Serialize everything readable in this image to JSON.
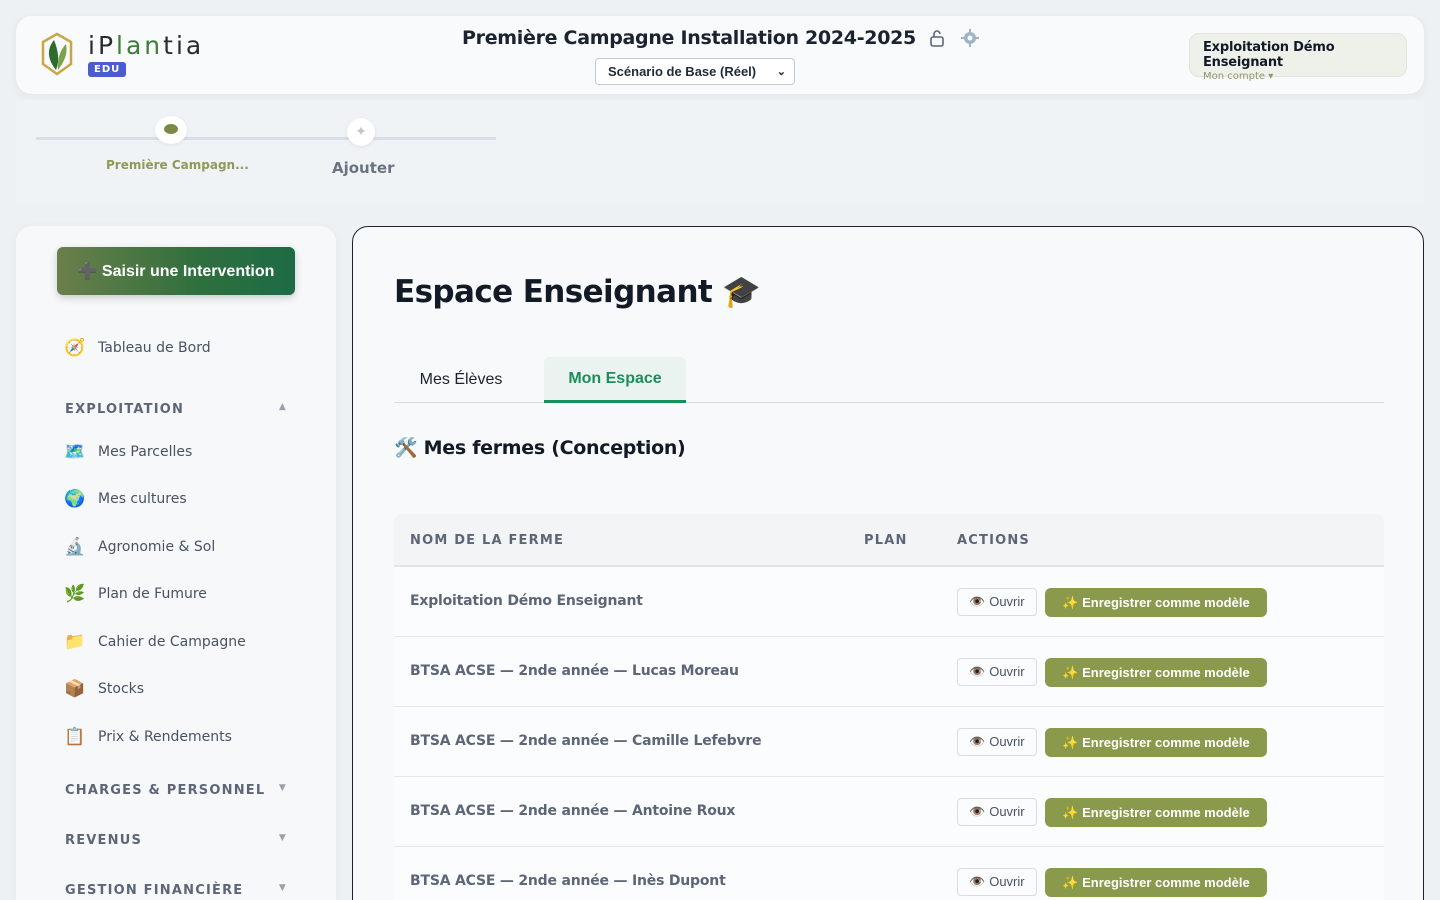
{
  "header": {
    "logo_text_prefix": "iP",
    "logo_text_green": "lan",
    "logo_text_suffix": "tia",
    "edu_badge": "EDU",
    "campaign_title": "Première Campagne Installation 2024-2025",
    "scenario": "Scénario de Base (Réel)",
    "account_name": "Exploitation Démo Enseignant",
    "account_sub": "Mon compte ▾"
  },
  "stepper": {
    "step1": "Première Campagn...",
    "step2": "Ajouter"
  },
  "sidebar": {
    "cta": "➕ Saisir une Intervention",
    "dashboard": {
      "icon": "🧭",
      "label": "Tableau de Bord"
    },
    "section_exploitation": "EXPLOITATION",
    "items": [
      {
        "icon": "🗺️",
        "label": "Mes Parcelles"
      },
      {
        "icon": "🌍",
        "label": "Mes cultures"
      },
      {
        "icon": "🔬",
        "label": "Agronomie & Sol"
      },
      {
        "icon": "🌿",
        "label": "Plan de Fumure"
      },
      {
        "icon": "📁",
        "label": "Cahier de Campagne"
      },
      {
        "icon": "📦",
        "label": "Stocks"
      },
      {
        "icon": "📋",
        "label": "Prix & Rendements"
      }
    ],
    "section_charges": "CHARGES & PERSONNEL",
    "section_revenus": "REVENUS",
    "section_gestion": "GESTION FINANCIÈRE",
    "arrow_up": "▲",
    "arrow_down": "▼"
  },
  "main": {
    "title": "Espace Enseignant 🎓",
    "tabs": [
      "Mes Élèves",
      "Mon Espace"
    ],
    "section_title": "🛠️ Mes fermes (Conception)",
    "columns": [
      "NOM DE LA FERME",
      "PLAN",
      "ACTIONS"
    ],
    "open_label": "👁️ Ouvrir",
    "model_label": "✨ Enregistrer comme modèle",
    "rows": [
      "Exploitation Démo Enseignant",
      "BTSA ACSE — 2nde année — Lucas Moreau",
      "BTSA ACSE — 2nde année — Camille Lefebvre",
      "BTSA ACSE — 2nde année — Antoine Roux",
      "BTSA ACSE — 2nde année — Inès Dupont"
    ]
  }
}
